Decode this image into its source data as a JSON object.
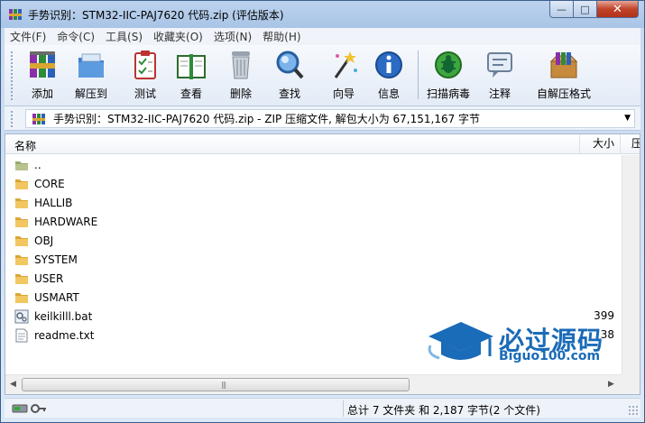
{
  "window": {
    "title": "手势识别：STM32-IIC-PAJ7620 代码.zip (评估版本)",
    "buttons": {
      "minimize": "—",
      "maximize": "□",
      "close": "✕"
    }
  },
  "menu": [
    "文件(F)",
    "命令(C)",
    "工具(S)",
    "收藏夹(O)",
    "选项(N)",
    "帮助(H)"
  ],
  "toolbar": [
    {
      "label": "添加",
      "icon": "add-icon"
    },
    {
      "label": "解压到",
      "icon": "extract-icon"
    },
    {
      "label": "测试",
      "icon": "test-icon"
    },
    {
      "label": "查看",
      "icon": "view-icon"
    },
    {
      "label": "删除",
      "icon": "delete-icon"
    },
    {
      "label": "查找",
      "icon": "find-icon"
    },
    {
      "label": "向导",
      "icon": "wizard-icon"
    },
    {
      "label": "信息",
      "icon": "info-icon"
    },
    {
      "label": "扫描病毒",
      "icon": "virus-scan-icon"
    },
    {
      "label": "注释",
      "icon": "comment-icon"
    },
    {
      "label": "自解压格式",
      "icon": "sfx-icon"
    }
  ],
  "address": {
    "text": "手势识别：STM32-IIC-PAJ7620 代码.zip - ZIP 压缩文件, 解包大小为 67,151,167 字节"
  },
  "list": {
    "columns": {
      "name": "名称",
      "size": "大小",
      "more": "压"
    },
    "rows": [
      {
        "name": "..",
        "size": "",
        "type": "up"
      },
      {
        "name": "CORE",
        "size": "",
        "type": "folder"
      },
      {
        "name": "HALLIB",
        "size": "",
        "type": "folder"
      },
      {
        "name": "HARDWARE",
        "size": "",
        "type": "folder"
      },
      {
        "name": "OBJ",
        "size": "",
        "type": "folder"
      },
      {
        "name": "SYSTEM",
        "size": "",
        "type": "folder"
      },
      {
        "name": "USER",
        "size": "",
        "type": "folder"
      },
      {
        "name": "USMART",
        "size": "",
        "type": "folder"
      },
      {
        "name": "keilkilll.bat",
        "size": "399",
        "type": "bat"
      },
      {
        "name": "readme.txt",
        "size": "38",
        "type": "txt"
      }
    ]
  },
  "watermark": {
    "title": "必过源码",
    "subtitle": "Biguo100.com"
  },
  "status": {
    "text": "总计 7 文件夹 和 2,187 字节(2 个文件)"
  },
  "colors": {
    "folder": "#e8b84a",
    "accent": "#1a6bb8",
    "close": "#c0442a"
  }
}
